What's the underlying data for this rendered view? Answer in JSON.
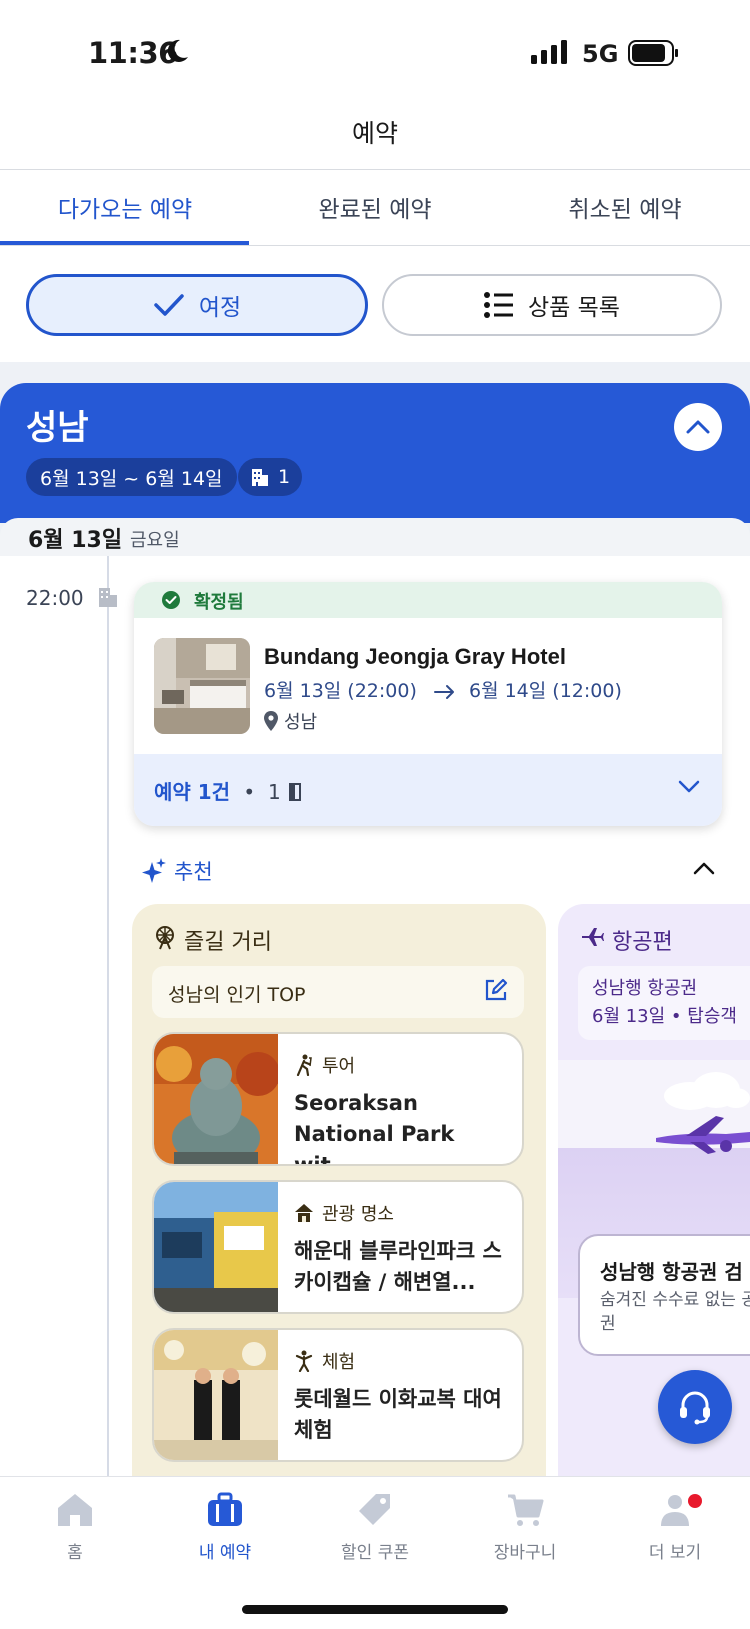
{
  "status_bar": {
    "time": "11:36",
    "network": "5G"
  },
  "header": {
    "title": "예약"
  },
  "tabs": [
    {
      "label": "다가오는 예약",
      "active": true
    },
    {
      "label": "완료된 예약",
      "active": false
    },
    {
      "label": "취소된 예약",
      "active": false
    }
  ],
  "view_toggle": {
    "itinerary": "여정",
    "product_list": "상품 목록"
  },
  "trip": {
    "city": "성남",
    "date_range": "6월 13일 ~ 6월 14일",
    "hotel_count": "1"
  },
  "day": {
    "date": "6월 13일",
    "weekday": "금요일"
  },
  "booking": {
    "time": "22:00",
    "status": "확정됨",
    "hotel_name": "Bundang Jeongja Gray Hotel",
    "checkin": "6월 13일 (22:00)",
    "checkout": "6월 14일 (12:00)",
    "location": "성남",
    "count_label": "예약 1건",
    "rooms": "1"
  },
  "recommend": {
    "label": "추천",
    "fun": {
      "title": "즐길 거리",
      "top_label": "성남의 인기 TOP",
      "items": [
        {
          "category": "투어",
          "title": "Seoraksan National Park wit..."
        },
        {
          "category": "관광 명소",
          "title": "해운대 블루라인파크 스카이캡슐 / 해변열..."
        },
        {
          "category": "체험",
          "title": "롯데월드 이화교복 대여 체험"
        }
      ]
    },
    "flight": {
      "title": "항공편",
      "info_line1": "성남행 항공권",
      "info_line2": "6월 13일 • 탑승객",
      "search_title": "성남행 항공권 검",
      "search_sub": "숨겨진 수수료 없는 공권"
    }
  },
  "bottom_nav": [
    {
      "label": "홈",
      "icon": "home-icon"
    },
    {
      "label": "내 예약",
      "icon": "suitcase-icon",
      "active": true
    },
    {
      "label": "할인 쿠폰",
      "icon": "tag-icon"
    },
    {
      "label": "장바구니",
      "icon": "cart-icon"
    },
    {
      "label": "더 보기",
      "icon": "person-icon"
    }
  ],
  "colors": {
    "accent": "#2659d6",
    "confirmed": "#1f7a3c",
    "fun_bg": "#f4efdb",
    "flight_bg": "#efeafb"
  }
}
